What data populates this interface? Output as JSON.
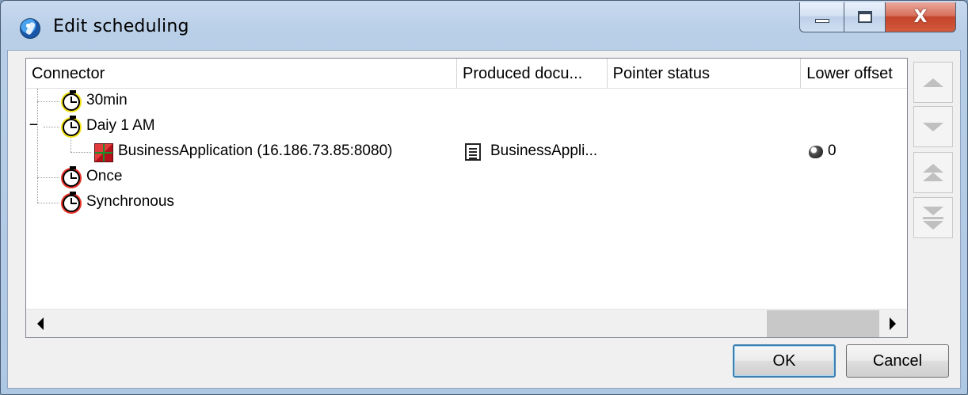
{
  "window": {
    "title": "Edit scheduling",
    "minimize_label": "",
    "maximize_label": "",
    "close_label": "X"
  },
  "list": {
    "columns": [
      {
        "label": "Connector"
      },
      {
        "label": "Produced docu..."
      },
      {
        "label": "Pointer status"
      },
      {
        "label": "Lower offset"
      }
    ],
    "rows": [
      {
        "name": "30min",
        "icon": "stopwatch-yellow-icon",
        "level": 0
      },
      {
        "name": "Daiy 1 AM",
        "icon": "stopwatch-yellow-icon",
        "level": 0,
        "expander": "−"
      },
      {
        "name": "BusinessApplication (16.186.73.85:8080)",
        "icon": "application-icon",
        "level": 1,
        "produced_document": "BusinessAppli...",
        "produced_document_icon": "document-icon",
        "pointer_status": "",
        "lower_offset": "0",
        "lower_offset_icon": "offset-icon"
      },
      {
        "name": "Once",
        "icon": "stopwatch-red-icon",
        "level": 0
      },
      {
        "name": "Synchronous",
        "icon": "stopwatch-red-icon",
        "level": 0
      }
    ]
  },
  "side_buttons": [
    "move-up",
    "move-down",
    "move-to-top",
    "move-to-bottom"
  ],
  "buttons": {
    "ok": "OK",
    "cancel": "Cancel"
  },
  "colors": {
    "title_bar": "#b9cfe8",
    "close_button": "#c4442c",
    "client_bg": "#f0f0f0",
    "default_button_border": "#3c7fb1"
  }
}
